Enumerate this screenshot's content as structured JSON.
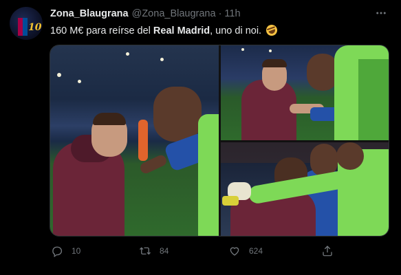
{
  "tweet": {
    "display_name": "Zona_Blaugrana",
    "handle": "@Zona_Blaugrana",
    "separator": "·",
    "time": "11h",
    "text_before": "160 M€ para reírse del ",
    "text_bold": "Real Madrid",
    "text_after": ", uno di noi.",
    "emoji": "rolling-on-the-floor-laughing-emoji",
    "avatar_number": "10"
  },
  "actions": {
    "reply_count": "10",
    "retweet_count": "84",
    "like_count": "624"
  },
  "colors": {
    "background": "#000000",
    "text": "#e7e9ea",
    "secondary_text": "#71767b"
  },
  "icons": {
    "reply": "reply-icon",
    "retweet": "retweet-icon",
    "like": "like-icon",
    "share": "share-icon",
    "more": "more-icon"
  }
}
